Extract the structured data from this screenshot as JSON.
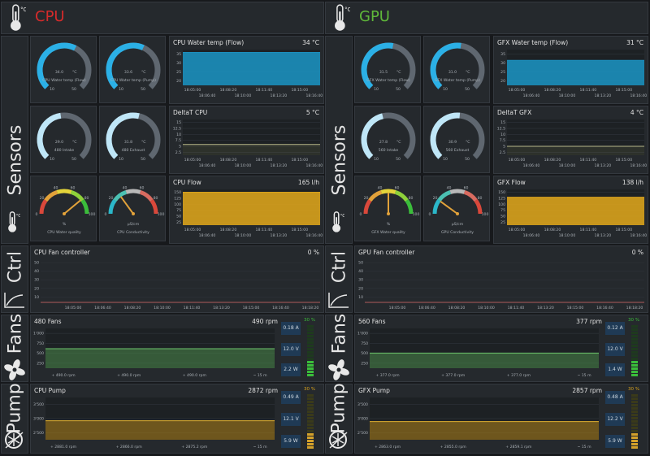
{
  "cpu": {
    "title": "CPU",
    "title_color": "#d62b2b",
    "side_sensors": "Sensors",
    "side_ctrl": "Ctrl",
    "side_fans": "Fans",
    "side_pump": "Pump",
    "gauges": [
      {
        "value": "34.0",
        "unit": "°C",
        "label": "CPU Water temp (Flow)",
        "min": "10",
        "max": "50",
        "color": "#2bb0e6",
        "fraction": 0.6
      },
      {
        "value": "33.6",
        "unit": "°C",
        "label": "CPU Water temp (Pump)",
        "min": "10",
        "max": "50",
        "color": "#2bb0e6",
        "fraction": 0.59
      },
      {
        "value": "29.0",
        "unit": "°C",
        "label": "480 Intake",
        "min": "10",
        "max": "50",
        "color": "#bfe6f7",
        "fraction": 0.47
      },
      {
        "value": "31.8",
        "unit": "°C",
        "label": "480 Exhaust",
        "min": "10",
        "max": "50",
        "color": "#bfe6f7",
        "fraction": 0.55
      }
    ],
    "quality": {
      "unit": "%",
      "label": "CPU Water quality",
      "ticks": [
        "0",
        "20",
        "40",
        "60",
        "80",
        "100"
      ],
      "fraction": 0.78
    },
    "conductivity": {
      "unit": "µS/cm",
      "label": "CPU Conductivity",
      "ticks": [
        "0",
        "20",
        "40",
        "60",
        "80",
        "100"
      ],
      "fraction": 0.3
    },
    "charts": {
      "water": {
        "title": "CPU Water temp (Flow)",
        "value": "34 °C",
        "y": [
          "35",
          "30",
          "25",
          "20"
        ],
        "x1": [
          "18:05:00",
          "18:08:20",
          "18:11:40",
          "18:15:00"
        ],
        "x2": [
          "18:06:40",
          "18:10:00",
          "18:13:20",
          "18:16:40"
        ],
        "level": 0.92,
        "color": "#1c8fbd"
      },
      "delta": {
        "title": "DeltaT CPU",
        "value": "5 °C",
        "y": [
          "15",
          "12.5",
          "10",
          "7.5",
          "5",
          "2.5"
        ],
        "x1": [
          "18:05:00",
          "18:08:20",
          "18:11:40",
          "18:15:00"
        ],
        "x2": [
          "18:06:40",
          "18:10:00",
          "18:13:20",
          "18:16:40"
        ],
        "level": 0.3,
        "color": "#8a8a55"
      },
      "flow": {
        "title": "CPU Flow",
        "value": "165 l/h",
        "y": [
          "150",
          "125",
          "100",
          "75",
          "50",
          "25"
        ],
        "x1": [
          "18:05:00",
          "18:08:20",
          "18:11:40",
          "18:15:00"
        ],
        "x2": [
          "18:06:40",
          "18:10:00",
          "18:13:20",
          "18:16:40"
        ],
        "level": 0.92,
        "color": "#d9a21c"
      }
    },
    "fanctrl": {
      "title": "CPU Fan controller",
      "value": "0 %",
      "y": [
        "50",
        "40",
        "30",
        "20",
        "10"
      ],
      "x": [
        "18:05:00",
        "18:06:40",
        "18:08:20",
        "18:10:00",
        "18:11:40",
        "18:13:20",
        "18:15:00",
        "18:16:40",
        "18:18:20"
      ]
    },
    "fans": {
      "title": "480 Fans",
      "value": "490 rpm",
      "y": [
        "1'000",
        "750",
        "500",
        "250"
      ],
      "legend": [
        "+ 490.0 rpm",
        "+ 490.0 rpm",
        "+ 490.0 rpm",
        "~ 15 m"
      ],
      "amps": "0.18 A",
      "volts": "12.0 V",
      "watts": "2.2 W",
      "pct": "30 %",
      "level": 0.49,
      "pct_frac": 0.3
    },
    "pump": {
      "title": "CPU Pump",
      "value": "2872 rpm",
      "y": [
        "3'500",
        "3'000",
        "2'500"
      ],
      "legend": [
        "+ 2881.0 rpm",
        "+ 2866.0 rpm",
        "+ 2875.2 rpm",
        "~ 15 m"
      ],
      "amps": "0.49 A",
      "volts": "12.1 V",
      "watts": "5.9 W",
      "pct": "30 %",
      "level": 0.45,
      "pct_frac": 0.3
    }
  },
  "gpu": {
    "title": "GPU",
    "title_color": "#5fb83a",
    "side_sensors": "Sensors",
    "side_ctrl": "Ctrl",
    "side_fans": "Fans",
    "side_pump": "Pump",
    "gauges": [
      {
        "value": "31.5",
        "unit": "°C",
        "label": "GFX Water temp (Flow)",
        "min": "10",
        "max": "50",
        "color": "#2bb0e6",
        "fraction": 0.54
      },
      {
        "value": "31.0",
        "unit": "°C",
        "label": "GFX Water temp (Pump)",
        "min": "10",
        "max": "50",
        "color": "#2bb0e6",
        "fraction": 0.53
      },
      {
        "value": "27.8",
        "unit": "°C",
        "label": "560 Intake",
        "min": "10",
        "max": "50",
        "color": "#bfe6f7",
        "fraction": 0.45
      },
      {
        "value": "30.9",
        "unit": "°C",
        "label": "560 Exhaust",
        "min": "10",
        "max": "50",
        "color": "#bfe6f7",
        "fraction": 0.52
      }
    ],
    "quality": {
      "unit": "%",
      "label": "GFX Water quality",
      "ticks": [
        "0",
        "20",
        "40",
        "60",
        "80",
        "100"
      ],
      "fraction": 0.5
    },
    "conductivity": {
      "unit": "µS/cm",
      "label": "GPU Conductivity",
      "ticks": [
        "0",
        "20",
        "40",
        "60",
        "80",
        "100"
      ],
      "fraction": 0.2
    },
    "charts": {
      "water": {
        "title": "GFX Water temp (Flow)",
        "value": "31 °C",
        "y": [
          "35",
          "30",
          "25",
          "20"
        ],
        "x1": [
          "18:05:00",
          "18:08:20",
          "18:11:40",
          "18:15:00"
        ],
        "x2": [
          "18:06:40",
          "18:10:00",
          "18:13:20",
          "18:16:40"
        ],
        "level": 0.7,
        "color": "#1c8fbd"
      },
      "delta": {
        "title": "DeltaT GFX",
        "value": "4 °C",
        "y": [
          "15",
          "12.5",
          "10",
          "7.5",
          "5",
          "2.5"
        ],
        "x1": [
          "18:05:00",
          "18:08:20",
          "18:11:40",
          "18:15:00"
        ],
        "x2": [
          "18:06:40",
          "18:10:00",
          "18:13:20",
          "18:16:40"
        ],
        "level": 0.25,
        "color": "#8a8a55"
      },
      "flow": {
        "title": "GFX Flow",
        "value": "138 l/h",
        "y": [
          "150",
          "125",
          "100",
          "75",
          "50",
          "25"
        ],
        "x1": [
          "18:05:00",
          "18:08:20",
          "18:11:40",
          "18:15:00"
        ],
        "x2": [
          "18:06:40",
          "18:10:00",
          "18:13:20",
          "18:16:40"
        ],
        "level": 0.78,
        "color": "#d9a21c"
      }
    },
    "fanctrl": {
      "title": "GPU Fan controller",
      "value": "0 %",
      "y": [
        "50",
        "40",
        "30",
        "20",
        "10"
      ],
      "x": [
        "18:05:00",
        "18:06:40",
        "18:08:20",
        "18:10:00",
        "18:11:40",
        "18:13:20",
        "18:15:00",
        "18:16:40",
        "18:18:20"
      ]
    },
    "fans": {
      "title": "560 Fans",
      "value": "377 rpm",
      "y": [
        "1'000",
        "750",
        "500",
        "250"
      ],
      "legend": [
        "+ 377.0 rpm",
        "+ 377.0 rpm",
        "+ 377.0 rpm",
        "~ 15 m"
      ],
      "amps": "0.12 A",
      "volts": "12.0 V",
      "watts": "1.4 W",
      "pct": "30 %",
      "level": 0.38,
      "pct_frac": 0.3
    },
    "pump": {
      "title": "GFX Pump",
      "value": "2857 rpm",
      "y": [
        "3'500",
        "3'000",
        "2'500"
      ],
      "legend": [
        "+ 2863.0 rpm",
        "+ 2855.0 rpm",
        "+ 2859.1 rpm",
        "~ 15 m"
      ],
      "amps": "0.48 A",
      "volts": "12.2 V",
      "watts": "5.9 W",
      "pct": "30 %",
      "level": 0.43,
      "pct_frac": 0.3
    }
  }
}
